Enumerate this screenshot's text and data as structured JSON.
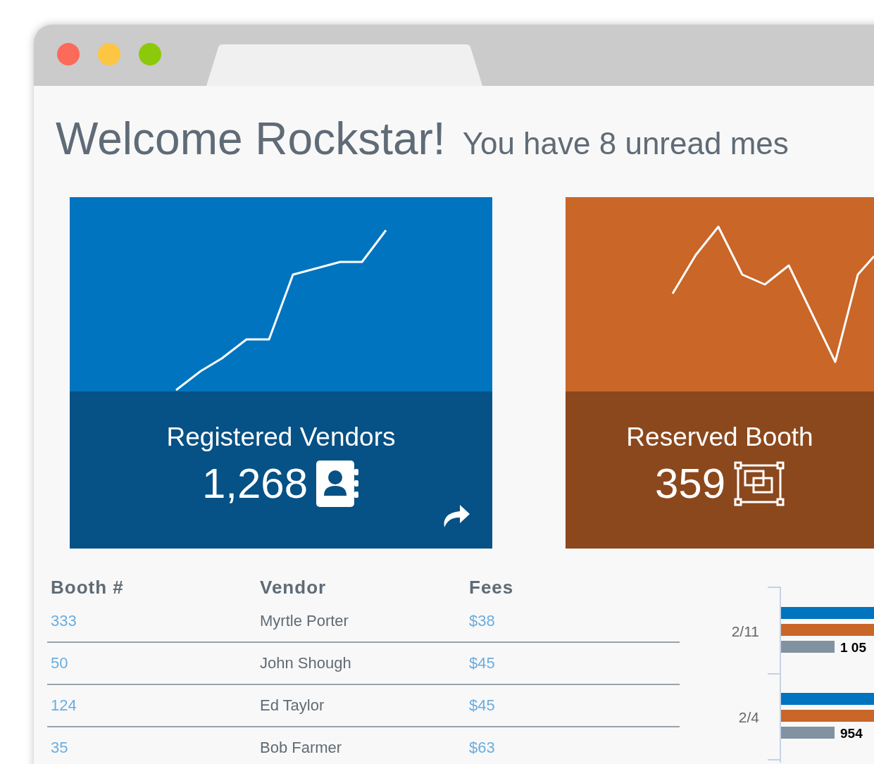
{
  "header": {
    "greeting": "Welcome Rockstar!",
    "message": "You have 8 unread mes"
  },
  "stat_cards": [
    {
      "kind": "vendors",
      "label": "Registered Vendors",
      "value": "1,268"
    },
    {
      "kind": "booths",
      "label": "Reserved Booth",
      "value": "359"
    }
  ],
  "table": {
    "columns": [
      "Booth #",
      "Vendor",
      "Fees"
    ],
    "rows": [
      {
        "booth": "333",
        "vendor": "Myrtle Porter",
        "fee": "$38"
      },
      {
        "booth": "50",
        "vendor": "John Shough",
        "fee": "$45"
      },
      {
        "booth": "124",
        "vendor": "Ed Taylor",
        "fee": "$45"
      },
      {
        "booth": "35",
        "vendor": "Bob Farmer",
        "fee": "$63"
      }
    ]
  },
  "side_chart": {
    "groups": [
      {
        "label": "2/11",
        "value_label": "1 05"
      },
      {
        "label": "2/4",
        "value_label": "954"
      }
    ]
  }
}
